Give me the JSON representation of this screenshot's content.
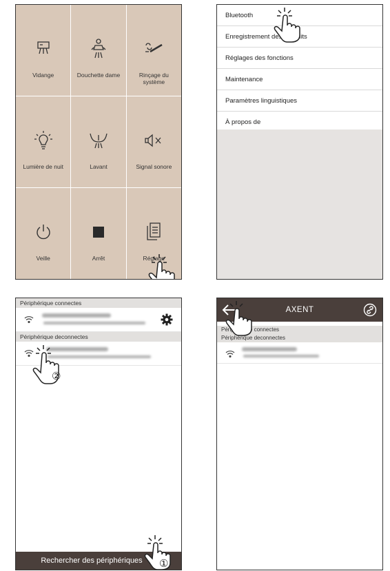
{
  "panel1": {
    "tiles": [
      {
        "label": "Vidange",
        "icon": "drain-icon"
      },
      {
        "label": "Douchette dame",
        "icon": "lady-wash-icon"
      },
      {
        "label": "Rinçage du système",
        "icon": "system-rinse-icon"
      },
      {
        "label": "Lumière de nuit",
        "icon": "night-light-icon"
      },
      {
        "label": "Lavant",
        "icon": "rear-wash-icon"
      },
      {
        "label": "Signal sonore",
        "icon": "sound-mute-icon"
      },
      {
        "label": "Veille",
        "icon": "power-icon"
      },
      {
        "label": "Arrêt",
        "icon": "stop-icon"
      },
      {
        "label": "Réglage",
        "icon": "settings-doc-icon"
      }
    ]
  },
  "panel2": {
    "menu": [
      {
        "label": "Bluetooth"
      },
      {
        "label": "Enregistrement des produits"
      },
      {
        "label": "Réglages des fonctions"
      },
      {
        "label": "Maintenance"
      },
      {
        "label": "Paramètres linguistiques"
      },
      {
        "label": "À propos de"
      }
    ]
  },
  "panel3": {
    "connected_header": "Périphérique connectes",
    "disconnected_header": "Périphérique deconnectes",
    "search_button": "Rechercher des périphériques",
    "step_markers": [
      "①",
      "②"
    ]
  },
  "panel4": {
    "title": "AXENT",
    "connected_header": "Périphérique connectes",
    "disconnected_header": "Périphérique deconnectes"
  },
  "colors": {
    "tile_bg": "#d9c8b8",
    "dark_bar": "#4a3f3b",
    "section_bg": "#e2e0de"
  }
}
